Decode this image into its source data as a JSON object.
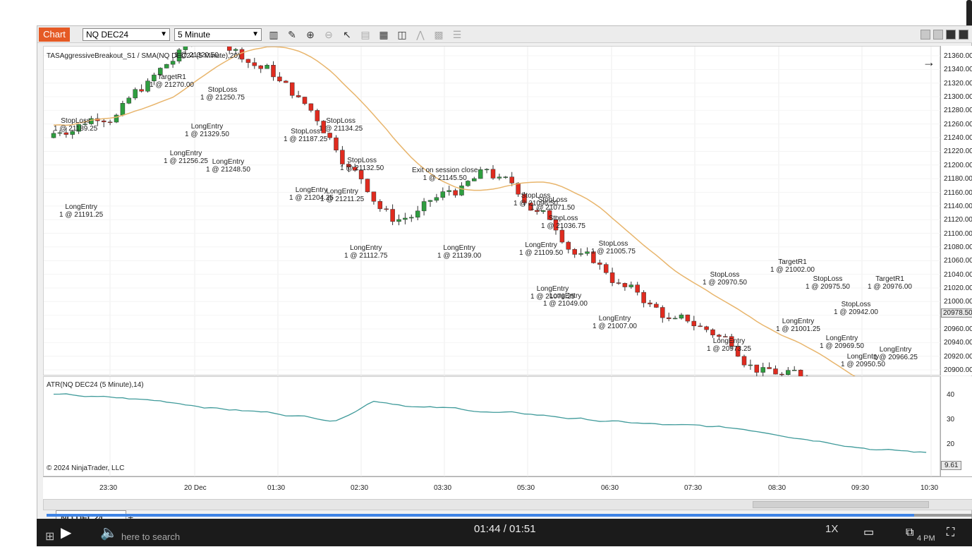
{
  "window": {
    "tab": "Chart",
    "instrument": "NQ DEC24",
    "interval": "5 Minute"
  },
  "price_panel": {
    "title": "TASAggressiveBreakout_S1 / SMA(NQ DEC24 (5 Minute),20)",
    "axis_ticks": [
      "21360.00",
      "21340.00",
      "21320.00",
      "21300.00",
      "21280.00",
      "21260.00",
      "21240.00",
      "21220.00",
      "21200.00",
      "21180.00",
      "21160.00",
      "21140.00",
      "21120.00",
      "21100.00",
      "21080.00",
      "21060.00",
      "21040.00",
      "21020.00",
      "21000.00",
      "20980.00",
      "20960.00",
      "20940.00",
      "20920.00",
      "20900.00"
    ],
    "current_price": "20978.50",
    "annotations": [
      {
        "t1": "StopLoss",
        "t2": "1 @ 21189.25"
      },
      {
        "t1": "LongEntry",
        "t2": "1 @ 21191.25"
      },
      {
        "t1": "TargetR1",
        "t2": "1 @ 21270.00"
      },
      {
        "t1": "",
        "t2": "1 @ 21320.50"
      },
      {
        "t1": "StopLoss",
        "t2": "1 @ 21250.75"
      },
      {
        "t1": "LongEntry",
        "t2": "1 @ 21256.25"
      },
      {
        "t1": "LongEntry",
        "t2": "1 @ 21329.50"
      },
      {
        "t1": "LongEntry",
        "t2": "1 @ 21248.50"
      },
      {
        "t1": "StopLoss",
        "t2": "1 @ 21187.25"
      },
      {
        "t1": "StopLoss",
        "t2": "1 @ 21134.25"
      },
      {
        "t1": "StopLoss",
        "t2": "1 @ 21132.50"
      },
      {
        "t1": "LongEntry",
        "t2": "1 @ 21204.25"
      },
      {
        "t1": "LongEntry",
        "t2": "1 @ 21211.25"
      },
      {
        "t1": "LongEntry",
        "t2": "1 @ 21112.75"
      },
      {
        "t1": "Exit on session close",
        "t2": "1 @ 21145.50"
      },
      {
        "t1": "LongEntry",
        "t2": "1 @ 21139.00"
      },
      {
        "t1": "StopLoss",
        "t2": "1 @ 21096.50"
      },
      {
        "t1": "StopLoss",
        "t2": "1 @ 21071.50"
      },
      {
        "t1": "StopLoss",
        "t2": "1 @ 21036.75"
      },
      {
        "t1": "LongEntry",
        "t2": "1 @ 21109.50"
      },
      {
        "t1": "LongEntry",
        "t2": "1 @ 21078.25"
      },
      {
        "t1": "LongEntry",
        "t2": "1 @ 21049.00"
      },
      {
        "t1": "StopLoss",
        "t2": "1 @ 21005.75"
      },
      {
        "t1": "LongEntry",
        "t2": "1 @ 21007.00"
      },
      {
        "t1": "StopLoss",
        "t2": "1 @ 20970.50"
      },
      {
        "t1": "LongEntry",
        "t2": "1 @ 20973.25"
      },
      {
        "t1": "TargetR1",
        "t2": "1 @ 21002.00"
      },
      {
        "t1": "LongEntry",
        "t2": "1 @ 21001.25"
      },
      {
        "t1": "StopLoss",
        "t2": "1 @ 20975.50"
      },
      {
        "t1": "StopLoss",
        "t2": "1 @ 20942.00"
      },
      {
        "t1": "TargetR1",
        "t2": "1 @ 20976.00"
      },
      {
        "t1": "LongEntry",
        "t2": "1 @ 20969.50"
      },
      {
        "t1": "LongEntry",
        "t2": "1 @ 20950.50"
      },
      {
        "t1": "LongEntry",
        "t2": "1 @ 20966.25"
      }
    ]
  },
  "atr_panel": {
    "title": "ATR(NQ DEC24 (5 Minute),14)",
    "axis_ticks": [
      "40",
      "30",
      "20"
    ],
    "current": "9.61",
    "copyright": "© 2024 NinjaTrader, LLC"
  },
  "time_axis": [
    "23:30",
    "20 Dec",
    "01:30",
    "02:30",
    "03:30",
    "05:30",
    "06:30",
    "07:30",
    "08:30",
    "09:30",
    "10:30"
  ],
  "bottom_tab": "NQ DEC24",
  "player": {
    "time": "01:44 / 01:51",
    "speed": "1X",
    "search": "here to search",
    "clock": "4 PM"
  },
  "colors": {
    "accent": "#e55a25",
    "up": "#2e9e3f",
    "down": "#e02b1f",
    "sma": "#e8b56c",
    "atr": "#3f9a9a",
    "buy": "#1a3ae6",
    "exit": "#ff22dd",
    "progress": "#3f84e5"
  }
}
